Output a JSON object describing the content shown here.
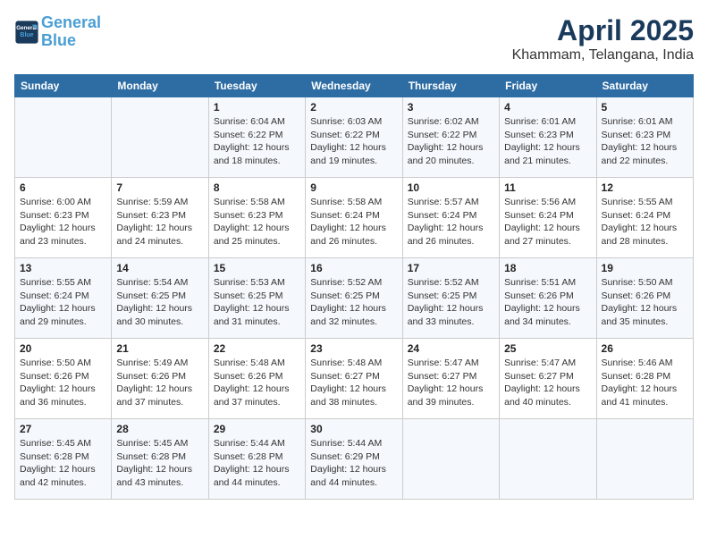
{
  "header": {
    "logo_line1": "General",
    "logo_line2": "Blue",
    "title": "April 2025",
    "subtitle": "Khammam, Telangana, India"
  },
  "weekdays": [
    "Sunday",
    "Monday",
    "Tuesday",
    "Wednesday",
    "Thursday",
    "Friday",
    "Saturday"
  ],
  "weeks": [
    [
      {
        "day": "",
        "info": ""
      },
      {
        "day": "",
        "info": ""
      },
      {
        "day": "1",
        "info": "Sunrise: 6:04 AM\nSunset: 6:22 PM\nDaylight: 12 hours and 18 minutes."
      },
      {
        "day": "2",
        "info": "Sunrise: 6:03 AM\nSunset: 6:22 PM\nDaylight: 12 hours and 19 minutes."
      },
      {
        "day": "3",
        "info": "Sunrise: 6:02 AM\nSunset: 6:22 PM\nDaylight: 12 hours and 20 minutes."
      },
      {
        "day": "4",
        "info": "Sunrise: 6:01 AM\nSunset: 6:23 PM\nDaylight: 12 hours and 21 minutes."
      },
      {
        "day": "5",
        "info": "Sunrise: 6:01 AM\nSunset: 6:23 PM\nDaylight: 12 hours and 22 minutes."
      }
    ],
    [
      {
        "day": "6",
        "info": "Sunrise: 6:00 AM\nSunset: 6:23 PM\nDaylight: 12 hours and 23 minutes."
      },
      {
        "day": "7",
        "info": "Sunrise: 5:59 AM\nSunset: 6:23 PM\nDaylight: 12 hours and 24 minutes."
      },
      {
        "day": "8",
        "info": "Sunrise: 5:58 AM\nSunset: 6:23 PM\nDaylight: 12 hours and 25 minutes."
      },
      {
        "day": "9",
        "info": "Sunrise: 5:58 AM\nSunset: 6:24 PM\nDaylight: 12 hours and 26 minutes."
      },
      {
        "day": "10",
        "info": "Sunrise: 5:57 AM\nSunset: 6:24 PM\nDaylight: 12 hours and 26 minutes."
      },
      {
        "day": "11",
        "info": "Sunrise: 5:56 AM\nSunset: 6:24 PM\nDaylight: 12 hours and 27 minutes."
      },
      {
        "day": "12",
        "info": "Sunrise: 5:55 AM\nSunset: 6:24 PM\nDaylight: 12 hours and 28 minutes."
      }
    ],
    [
      {
        "day": "13",
        "info": "Sunrise: 5:55 AM\nSunset: 6:24 PM\nDaylight: 12 hours and 29 minutes."
      },
      {
        "day": "14",
        "info": "Sunrise: 5:54 AM\nSunset: 6:25 PM\nDaylight: 12 hours and 30 minutes."
      },
      {
        "day": "15",
        "info": "Sunrise: 5:53 AM\nSunset: 6:25 PM\nDaylight: 12 hours and 31 minutes."
      },
      {
        "day": "16",
        "info": "Sunrise: 5:52 AM\nSunset: 6:25 PM\nDaylight: 12 hours and 32 minutes."
      },
      {
        "day": "17",
        "info": "Sunrise: 5:52 AM\nSunset: 6:25 PM\nDaylight: 12 hours and 33 minutes."
      },
      {
        "day": "18",
        "info": "Sunrise: 5:51 AM\nSunset: 6:26 PM\nDaylight: 12 hours and 34 minutes."
      },
      {
        "day": "19",
        "info": "Sunrise: 5:50 AM\nSunset: 6:26 PM\nDaylight: 12 hours and 35 minutes."
      }
    ],
    [
      {
        "day": "20",
        "info": "Sunrise: 5:50 AM\nSunset: 6:26 PM\nDaylight: 12 hours and 36 minutes."
      },
      {
        "day": "21",
        "info": "Sunrise: 5:49 AM\nSunset: 6:26 PM\nDaylight: 12 hours and 37 minutes."
      },
      {
        "day": "22",
        "info": "Sunrise: 5:48 AM\nSunset: 6:26 PM\nDaylight: 12 hours and 37 minutes."
      },
      {
        "day": "23",
        "info": "Sunrise: 5:48 AM\nSunset: 6:27 PM\nDaylight: 12 hours and 38 minutes."
      },
      {
        "day": "24",
        "info": "Sunrise: 5:47 AM\nSunset: 6:27 PM\nDaylight: 12 hours and 39 minutes."
      },
      {
        "day": "25",
        "info": "Sunrise: 5:47 AM\nSunset: 6:27 PM\nDaylight: 12 hours and 40 minutes."
      },
      {
        "day": "26",
        "info": "Sunrise: 5:46 AM\nSunset: 6:28 PM\nDaylight: 12 hours and 41 minutes."
      }
    ],
    [
      {
        "day": "27",
        "info": "Sunrise: 5:45 AM\nSunset: 6:28 PM\nDaylight: 12 hours and 42 minutes."
      },
      {
        "day": "28",
        "info": "Sunrise: 5:45 AM\nSunset: 6:28 PM\nDaylight: 12 hours and 43 minutes."
      },
      {
        "day": "29",
        "info": "Sunrise: 5:44 AM\nSunset: 6:28 PM\nDaylight: 12 hours and 44 minutes."
      },
      {
        "day": "30",
        "info": "Sunrise: 5:44 AM\nSunset: 6:29 PM\nDaylight: 12 hours and 44 minutes."
      },
      {
        "day": "",
        "info": ""
      },
      {
        "day": "",
        "info": ""
      },
      {
        "day": "",
        "info": ""
      }
    ]
  ]
}
